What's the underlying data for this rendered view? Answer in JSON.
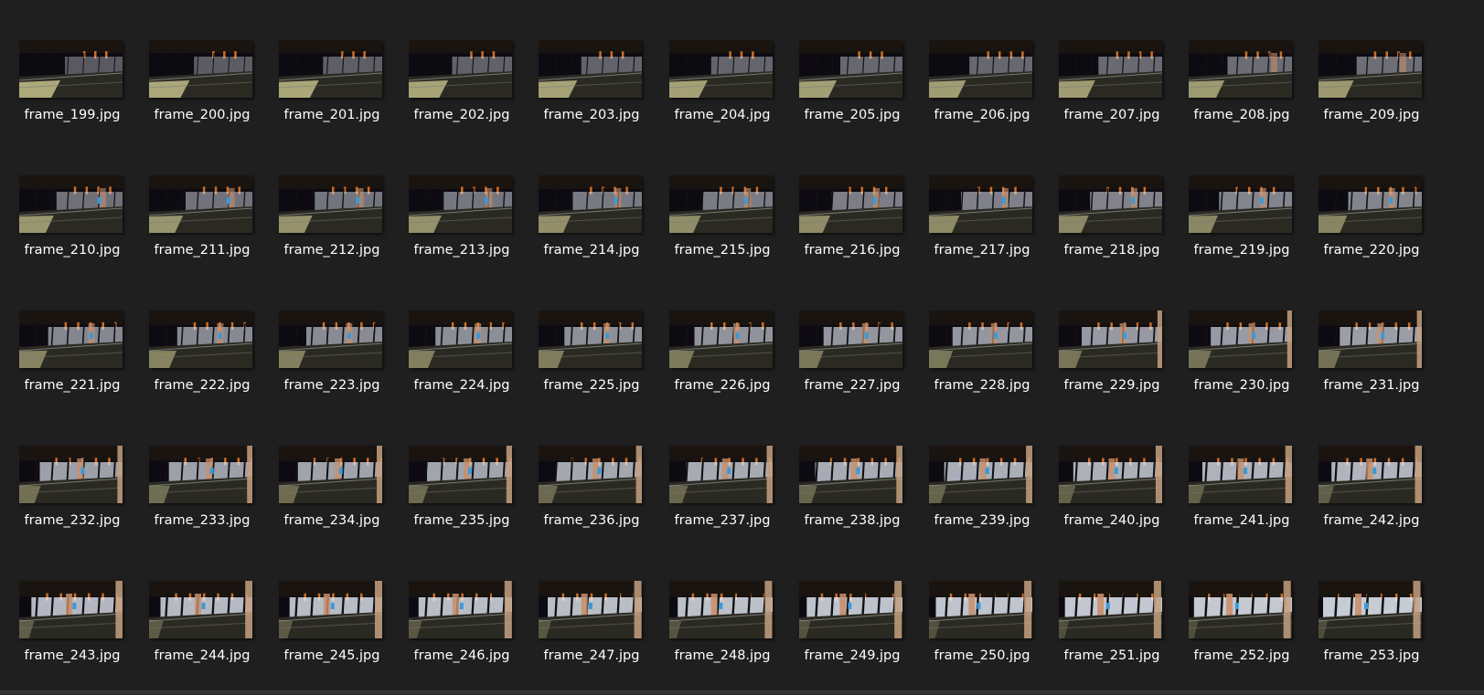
{
  "window": {
    "view": "Large icons",
    "theme_background": "#1f1f1f",
    "label_color": "#ffffff"
  },
  "files": [
    "frame_199.jpg",
    "frame_200.jpg",
    "frame_201.jpg",
    "frame_202.jpg",
    "frame_203.jpg",
    "frame_204.jpg",
    "frame_205.jpg",
    "frame_206.jpg",
    "frame_207.jpg",
    "frame_208.jpg",
    "frame_209.jpg",
    "frame_210.jpg",
    "frame_211.jpg",
    "frame_212.jpg",
    "frame_213.jpg",
    "frame_214.jpg",
    "frame_215.jpg",
    "frame_216.jpg",
    "frame_217.jpg",
    "frame_218.jpg",
    "frame_219.jpg",
    "frame_220.jpg",
    "frame_221.jpg",
    "frame_222.jpg",
    "frame_223.jpg",
    "frame_224.jpg",
    "frame_225.jpg",
    "frame_226.jpg",
    "frame_227.jpg",
    "frame_228.jpg",
    "frame_229.jpg",
    "frame_230.jpg",
    "frame_231.jpg",
    "frame_232.jpg",
    "frame_233.jpg",
    "frame_234.jpg",
    "frame_235.jpg",
    "frame_236.jpg",
    "frame_237.jpg",
    "frame_238.jpg",
    "frame_239.jpg",
    "frame_240.jpg",
    "frame_241.jpg",
    "frame_242.jpg",
    "frame_243.jpg",
    "frame_244.jpg",
    "frame_245.jpg",
    "frame_246.jpg",
    "frame_247.jpg",
    "frame_248.jpg",
    "frame_249.jpg",
    "frame_250.jpg",
    "frame_251.jpg",
    "frame_252.jpg",
    "frame_253.jpg"
  ],
  "thumbnail_icon": "image-thumbnail-icon",
  "scene_colors": {
    "sky": "#0d0a12",
    "lamp": "#e0782a",
    "floor_dark": "#2b2a22",
    "floor_light": "#d8d49a",
    "window_light": "#e8eef8",
    "pillar": "#c98f6a",
    "blue_screen": "#3a9ad8"
  }
}
